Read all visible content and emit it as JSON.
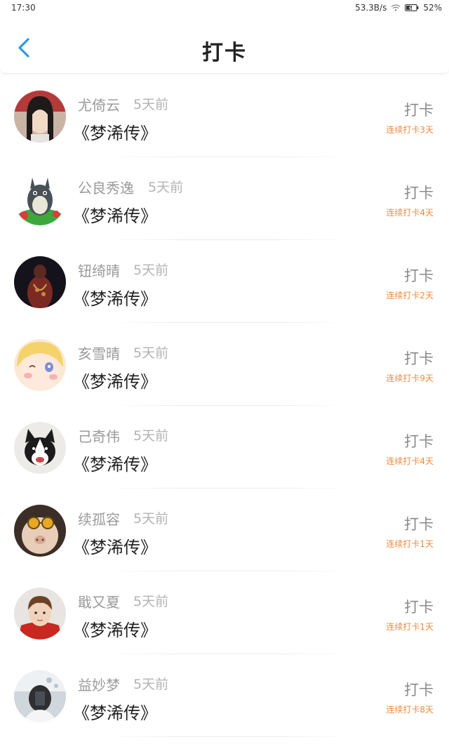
{
  "status_bar": {
    "time": "17:30",
    "net_speed": "53.3B/s",
    "battery": "52%"
  },
  "header": {
    "title": "打卡",
    "back_icon": "chevron-left-icon",
    "accent_color": "#2d9cdb"
  },
  "items": [
    {
      "name": "尤倚云",
      "time": "5天前",
      "book": "《梦浠传》",
      "action": "打卡",
      "streak": "连续打卡3天",
      "avatar": "girl-portrait"
    },
    {
      "name": "公良秀逸",
      "time": "5天前",
      "book": "《梦浠传》",
      "action": "打卡",
      "streak": "连续打卡4天",
      "avatar": "totoro"
    },
    {
      "name": "钮绮晴",
      "time": "5天前",
      "book": "《梦浠传》",
      "action": "打卡",
      "streak": "连续打卡2天",
      "avatar": "dark-figure"
    },
    {
      "name": "亥雪晴",
      "time": "5天前",
      "book": "《梦浠传》",
      "action": "打卡",
      "streak": "连续打卡9天",
      "avatar": "anime-face"
    },
    {
      "name": "己奇伟",
      "time": "5天前",
      "book": "《梦浠传》",
      "action": "打卡",
      "streak": "连续打卡4天",
      "avatar": "husky"
    },
    {
      "name": "续孤容",
      "time": "5天前",
      "book": "《梦浠传》",
      "action": "打卡",
      "streak": "连续打卡1天",
      "avatar": "cat-sunglasses"
    },
    {
      "name": "戢又夏",
      "time": "5天前",
      "book": "《梦浠传》",
      "action": "打卡",
      "streak": "连续打卡1天",
      "avatar": "boy-red-coat"
    },
    {
      "name": "益妙梦",
      "time": "5天前",
      "book": "《梦浠传》",
      "action": "打卡",
      "streak": "连续打卡8天",
      "avatar": "mirror-selfie"
    }
  ]
}
